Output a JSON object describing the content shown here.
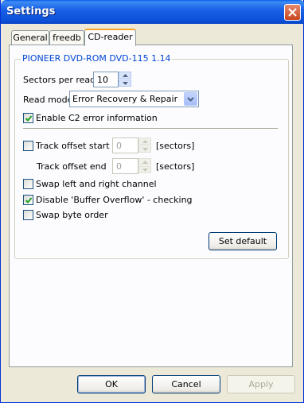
{
  "window": {
    "title": "Settings"
  },
  "tabs": [
    {
      "label": "General"
    },
    {
      "label": "freedb"
    },
    {
      "label": "CD-reader"
    }
  ],
  "cd_reader": {
    "device": "PIONEER DVD-ROM DVD-115 1.14",
    "sectors_per_read": {
      "label": "Sectors per read",
      "value": "10"
    },
    "read_mode": {
      "label": "Read mode",
      "value": "Error Recovery & Repair"
    },
    "enable_c2": {
      "label": "Enable C2 error information",
      "checked": true
    },
    "track_offset_start": {
      "label": "Track offset start",
      "value": "0",
      "unit": "[sectors]",
      "checked": false
    },
    "track_offset_end": {
      "label": "Track offset end",
      "value": "0",
      "unit": "[sectors]"
    },
    "swap_channels": {
      "label": "Swap left and right channel",
      "checked": false
    },
    "disable_buffer_overflow": {
      "label": "Disable 'Buffer Overflow' - checking",
      "checked": true
    },
    "swap_byte_order": {
      "label": "Swap byte order",
      "checked": false
    },
    "set_default_label": "Set default"
  },
  "footer": {
    "ok_label": "OK",
    "cancel_label": "Cancel",
    "apply_label": "Apply"
  }
}
